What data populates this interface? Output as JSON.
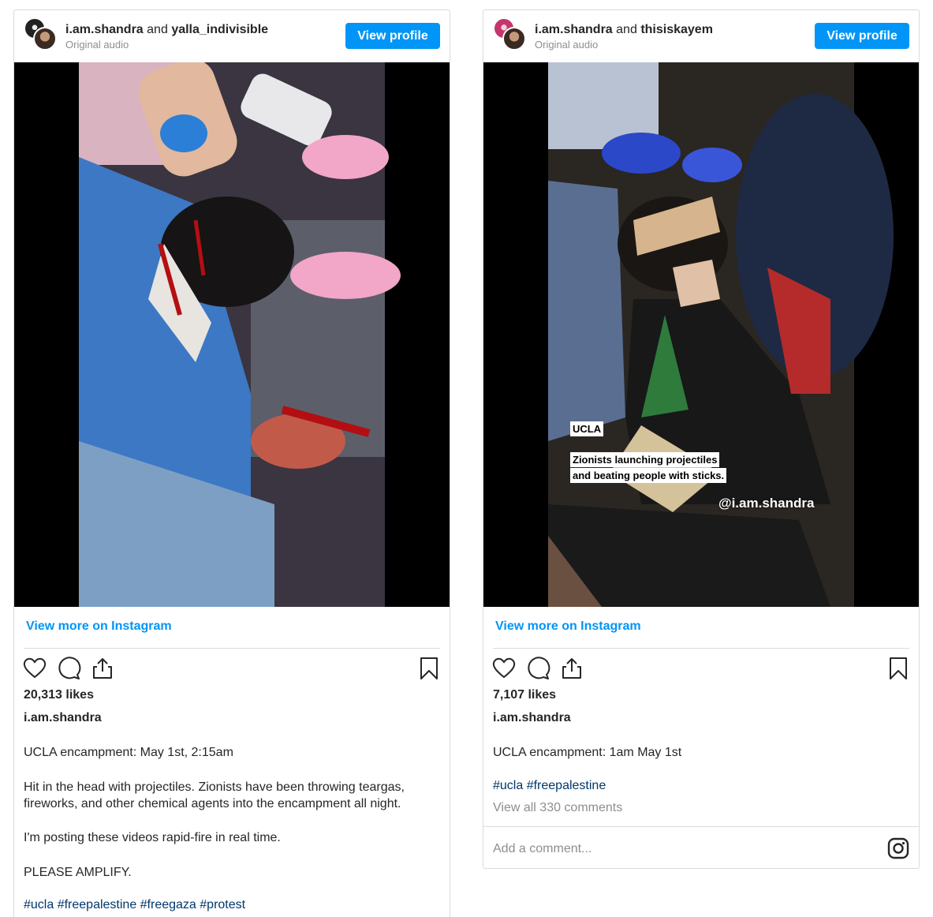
{
  "posts": [
    {
      "user1": "i.am.shandra",
      "conj": "and",
      "user2": "yalla_indivisible",
      "audio": "Original audio",
      "view_profile": "View profile",
      "view_more": "View more on Instagram",
      "likes": "20,313 likes",
      "author": "i.am.shandra",
      "caption": [
        "UCLA encampment: May 1st, 2:15am",
        "Hit in the head with projectiles. Zionists have been throwing teargas,",
        "fireworks, and other chemical agents into the encampment all night.",
        "I'm posting these videos rapid-fire in real time.",
        "PLEASE AMPLIFY."
      ],
      "hashtags": "#ucla #freepalestine #freegaza #protest"
    },
    {
      "user1": "i.am.shandra",
      "conj": "and",
      "user2": "thisiskayem",
      "audio": "Original audio",
      "view_profile": "View profile",
      "view_more": "View more on Instagram",
      "likes": "7,107 likes",
      "author": "i.am.shandra",
      "caption": [
        "UCLA encampment: 1am May 1st"
      ],
      "hashtags": "#ucla #freepalestine",
      "view_all": "View all 330 comments",
      "comment_placeholder": "Add a comment...",
      "video_overlay": {
        "tag": "UCLA",
        "line1": "Zionists launching projectiles",
        "line2": "and beating people with sticks.",
        "handle": "@i.am.shandra"
      }
    }
  ],
  "icons": {
    "like": "heart-icon",
    "comment": "comment-icon",
    "share": "share-icon",
    "save": "bookmark-icon",
    "instagram": "instagram-logo-icon"
  },
  "colors": {
    "accent": "#0095f6",
    "hashtag": "#00376b",
    "muted": "#8e8e8e",
    "border": "#dbdbdb"
  }
}
